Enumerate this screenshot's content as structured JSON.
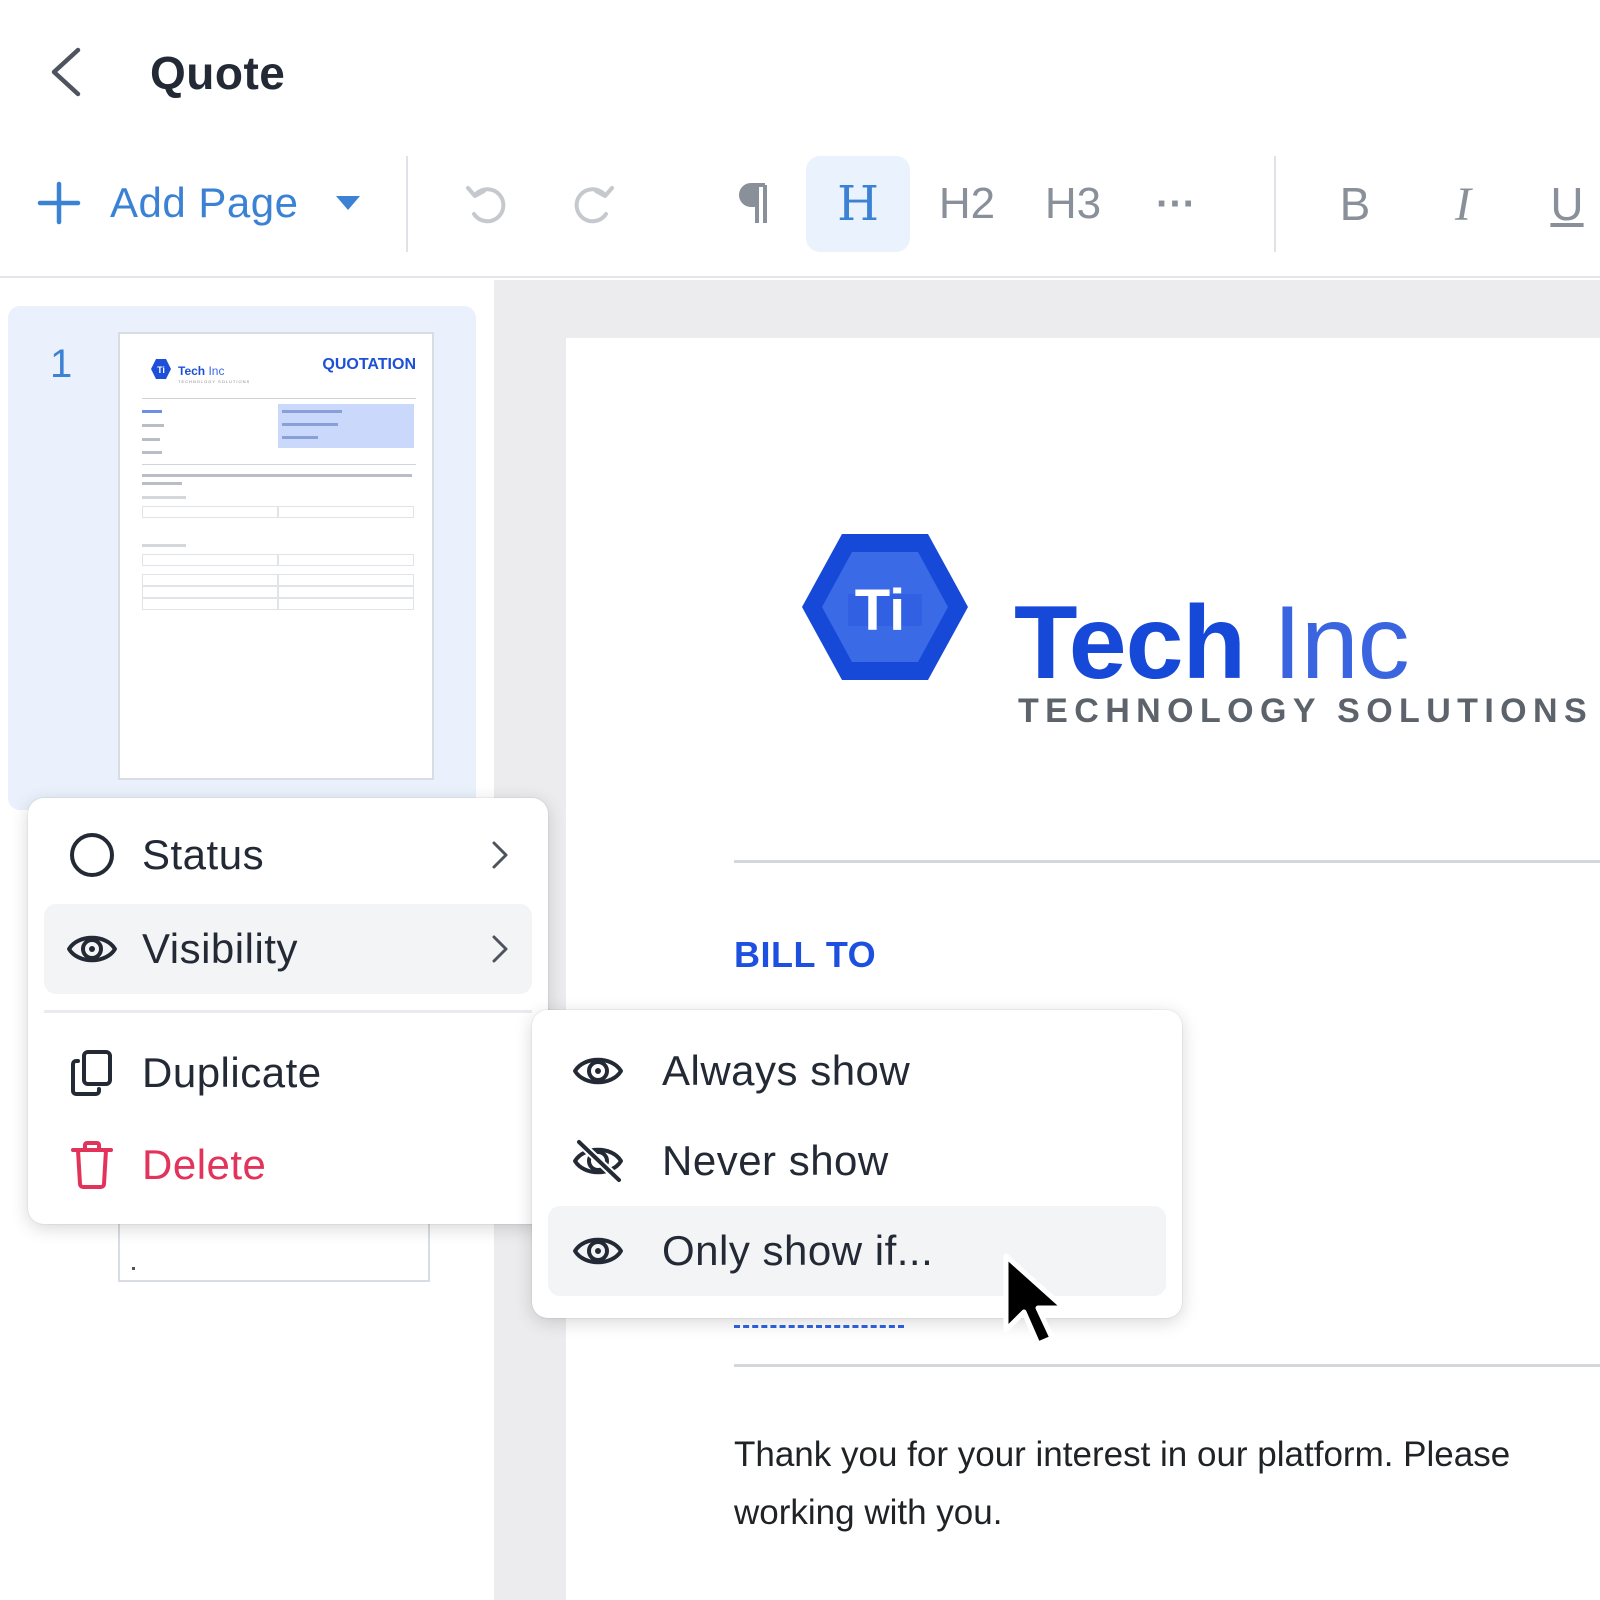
{
  "header": {
    "title": "Quote"
  },
  "toolbar": {
    "add_page_label": "Add Page",
    "heading_h": "H",
    "heading_h2": "H2",
    "heading_h3": "H3",
    "more": "···",
    "bold": "B",
    "italic": "I",
    "underline": "U"
  },
  "sidebar": {
    "pages": [
      {
        "number": "1",
        "thumb_title": "QUOTATION",
        "thumb_brand_bold": "Tech",
        "thumb_brand_light": "Inc",
        "thumb_subtitle": "TECHNOLOGY SOLUTIONS"
      }
    ]
  },
  "document": {
    "logo_letters": "Ti",
    "brand_bold": "Tech",
    "brand_light": "Inc",
    "tagline": "TECHNOLOGY SOLUTIONS",
    "bill_to": "BILL TO",
    "intro_line1": "Thank you for your interest in our platform. Please",
    "intro_line2": "working with you."
  },
  "context_menu": {
    "status": "Status",
    "visibility": "Visibility",
    "duplicate": "Duplicate",
    "delete": "Delete"
  },
  "visibility_submenu": {
    "always": "Always show",
    "never": "Never show",
    "only_if": "Only show if..."
  },
  "colors": {
    "accent": "#3b82d4",
    "brand": "#1649d8",
    "danger": "#e2345a"
  }
}
